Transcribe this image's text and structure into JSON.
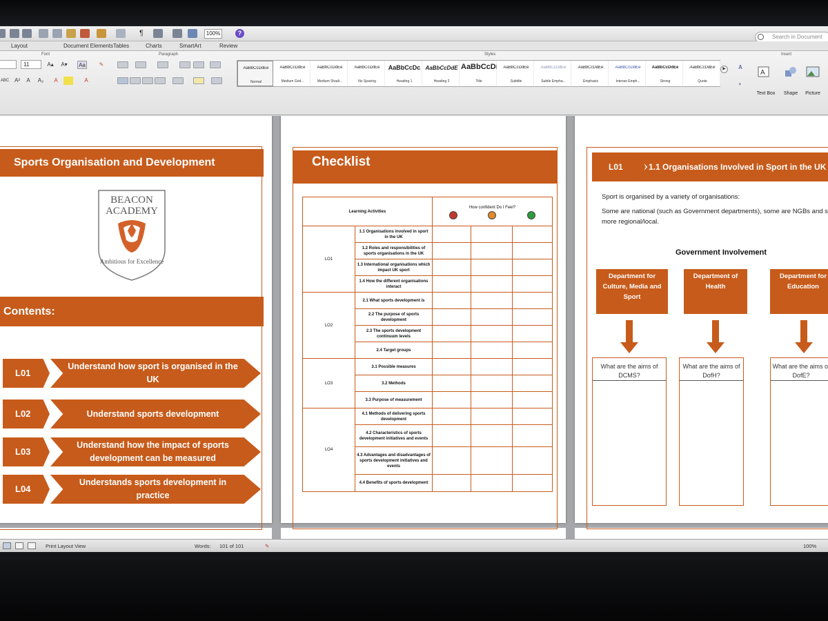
{
  "toolbar": {
    "zoom": "100%",
    "search_placeholder": "Search in Document"
  },
  "ribbon_tabs": [
    "Layout",
    "Document Elements",
    "Tables",
    "Charts",
    "SmartArt",
    "Review"
  ],
  "ribbon": {
    "font_label": "Font",
    "paragraph_label": "Paragraph",
    "styles_label": "Styles",
    "insert_label": "Insert",
    "font_size": "11",
    "styles": [
      {
        "sample": "AaBbCcDdEe",
        "name": "Normal"
      },
      {
        "sample": "AaBbCcDdEe",
        "name": "Medium Grid..."
      },
      {
        "sample": "AaBbCcDdEe",
        "name": "Medium Shadi..."
      },
      {
        "sample": "AaBbCcDdEe",
        "name": "No Spacing"
      },
      {
        "sample": "AaBbCcDc",
        "name": "Heading 1"
      },
      {
        "sample": "AaBbCcDdE",
        "name": "Heading 2"
      },
      {
        "sample": "AaBbCcDı",
        "name": "Title"
      },
      {
        "sample": "AaBbCcDdEe",
        "name": "Subtitle"
      },
      {
        "sample": "AaBbCcDdEe",
        "name": "Subtle Empha..."
      },
      {
        "sample": "AaBbCcDdEe",
        "name": "Emphasis"
      },
      {
        "sample": "AaBbCcDdEe",
        "name": "Intense Emph..."
      },
      {
        "sample": "AaBbCcDdEe",
        "name": "Strong"
      },
      {
        "sample": "AaBbCcDdEe",
        "name": "Quote"
      }
    ],
    "insert_items": [
      "Text Box",
      "Shape",
      "Picture"
    ]
  },
  "page1": {
    "title": "Sports Organisation and Development",
    "logo_line1": "BEACON",
    "logo_line2": "ACADEMY",
    "logo_motto": "Ambitious for Excellence",
    "contents_label": "Contents:",
    "outcomes": [
      {
        "code": "L01",
        "text": "Understand how sport is organised in the UK"
      },
      {
        "code": "L02",
        "text": "Understand sports development"
      },
      {
        "code": "L03",
        "text": "Understand how the impact of sports development can be measured"
      },
      {
        "code": "L04",
        "text": "Understands sports development in practice"
      }
    ]
  },
  "page2": {
    "title": "Checklist",
    "header_activities": "Learning Activities",
    "header_confidence": "How confident Do I Feel?",
    "confidence_colors": [
      "#c0392b",
      "#e08a2c",
      "#2e9a3b"
    ],
    "groups": [
      {
        "lo": "LO1",
        "activities": [
          "1.1 Organisations involved in sport in the UK",
          "1.2 Roles and responsibilities of sports organisations in the UK",
          "1.3 International organisations which impact UK sport",
          "1.4 How the different organisations interact"
        ]
      },
      {
        "lo": "LO2",
        "activities": [
          "2.1 What sports development is",
          "2.2 The purpose of sports development",
          "2.3 The sports development continuum levels",
          "2.4 Target groups"
        ]
      },
      {
        "lo": "LO3",
        "activities": [
          "3.1 Possible measures",
          "3.2 Methods",
          "3.3 Purpose of measurement"
        ]
      },
      {
        "lo": "LO4",
        "activities": [
          "4.1 Methods of delivering sports development",
          "4.2 Characteristics of sports development initiatives and events",
          "4.3 Advantages and disadvantages of sports development initiatives and events",
          "4.4 Benefits of sports development"
        ]
      }
    ]
  },
  "page3": {
    "lo_code": "L01",
    "header": "1.1 Organisations Involved in Sport in the UK",
    "intro": "Sport is organised by a variety of organisations:",
    "detail_line1": "Some are national (such as Government departments), some are NGBs and some a",
    "detail_line2": "more regional/local.",
    "gov_title": "Government Involvement",
    "departments": [
      {
        "name": "Department for Culture, Media and Sport",
        "question": "What are the aims of DCMS?"
      },
      {
        "name": "Department of Health",
        "question": "What are the aims of DofH?"
      },
      {
        "name": "Department for Education",
        "question": "What are the aims of DofE?"
      }
    ]
  },
  "statusbar": {
    "view": "Print Layout View",
    "words_label": "Words:",
    "words_value": "101 of 101",
    "zoom": "100%"
  },
  "colors": {
    "accent_orange": "#c75b1b",
    "page_bg": "#ffffff",
    "workspace": "#a6a7aa"
  }
}
